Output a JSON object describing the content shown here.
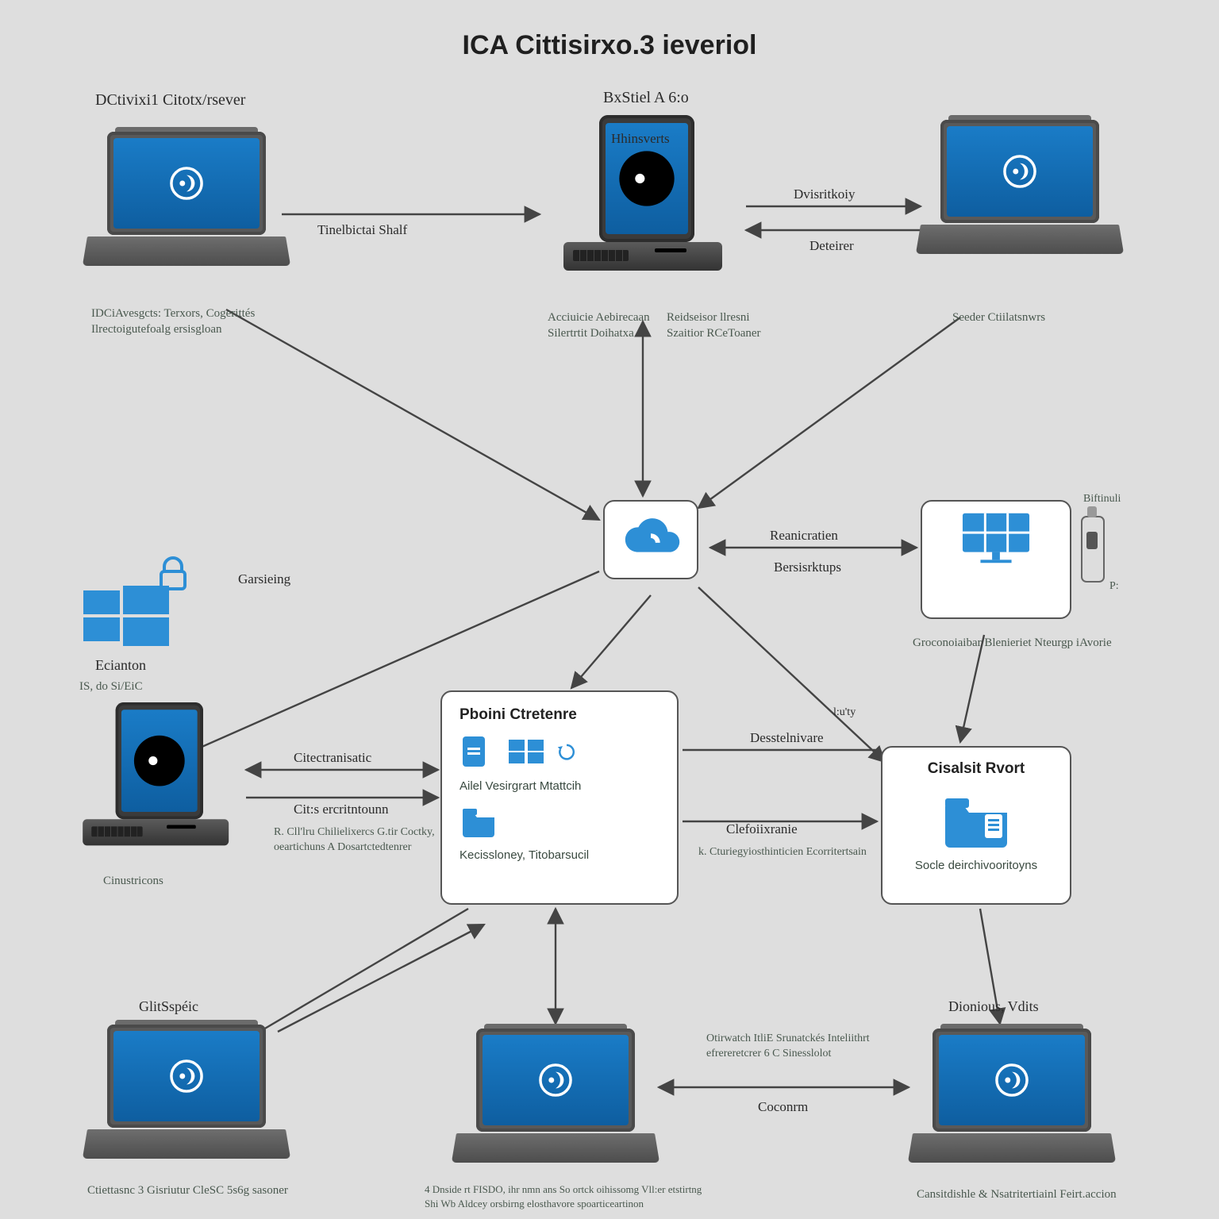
{
  "title": "ICA Cittisirxo.3 ieveriol",
  "nodes": {
    "topLeft": {
      "header": "DCtivixi1 Citotx/rsever",
      "sub": "IDCiAvesgcts: Terxors, Cogerittés  Ilrectoigutefoalg ersisgloan"
    },
    "topMid": {
      "header": "BxStiel A 6:o",
      "sub1": "Acciuicie Aebirecaan  Silertrtit Doihatxa",
      "sub2": "Reidseisor llresni  Szaitior RCeToaner"
    },
    "topRight": {
      "header": "",
      "sub": "Seeder Ctiilatsnwrs"
    },
    "cloud": {},
    "gridRight": {
      "sideTop": "Biftinuli",
      "sideBottom": "P:",
      "sub": "Groconoiaibar Blenieriet Nteurgp iAvorie"
    },
    "leftEdition": {
      "label": "Ecianton",
      "sub": "IS, do Si/EiC"
    },
    "tabletLeft": {
      "sub": "Cinustricons"
    },
    "pbox": {
      "header": "Pboini Ctretenre",
      "row1": "Ailel Vesirgrart Mtattcih",
      "row2": "",
      "row3": "Kecissloney, Titobarsucil"
    },
    "cbox": {
      "header": "Cisalsit Rvort",
      "sub": "Socle deirchivooritoyns"
    },
    "botLeft": {
      "header": "GlitSspéic",
      "sub": "Ctiettasnc 3 Gisriutur CleSC  5s6g sasoner"
    },
    "botMid": {
      "sub": "4 Dnside rt FISDO, ihr nmn ans So ortck oihissomg  Vll:er etstirtng Shi Wb Aldcey orsbirng elosthavore  spoarticeartinon"
    },
    "botRight": {
      "header": "Dionious, Vdits",
      "sub": "Cansitdishle & Nsatritertiainl  Feirt.accion"
    }
  },
  "edges": {
    "e1": "Tinelbictai Shalf",
    "e2": "Hhinsverts",
    "e3": "Dvisritkoiy",
    "e4": "Deteirer",
    "e5": "Reanicratien",
    "e6": "Bersisrktups",
    "e7": "Garsieing",
    "e8": "Citectranisatic",
    "e9": "Cit:s ercritntounn",
    "e10": "R. Cll'lru Chilielixercs  G.tir Coctky, oeartichuns  A Dosartctedtenrer",
    "e11": "Desstelnivare",
    "e12": "l:u'ty",
    "e13": "Clefoiixranie",
    "e14": "k. Cturiegyiosthinticien  Ecorritertsain",
    "e15": "Otirwatch ItliE Srunatckés  Inteliithrt efrereretcrer 6  C Sinesslolot",
    "e16": "Coconrm"
  },
  "colors": {
    "accent": "#2d8fd6",
    "line": "#444"
  }
}
